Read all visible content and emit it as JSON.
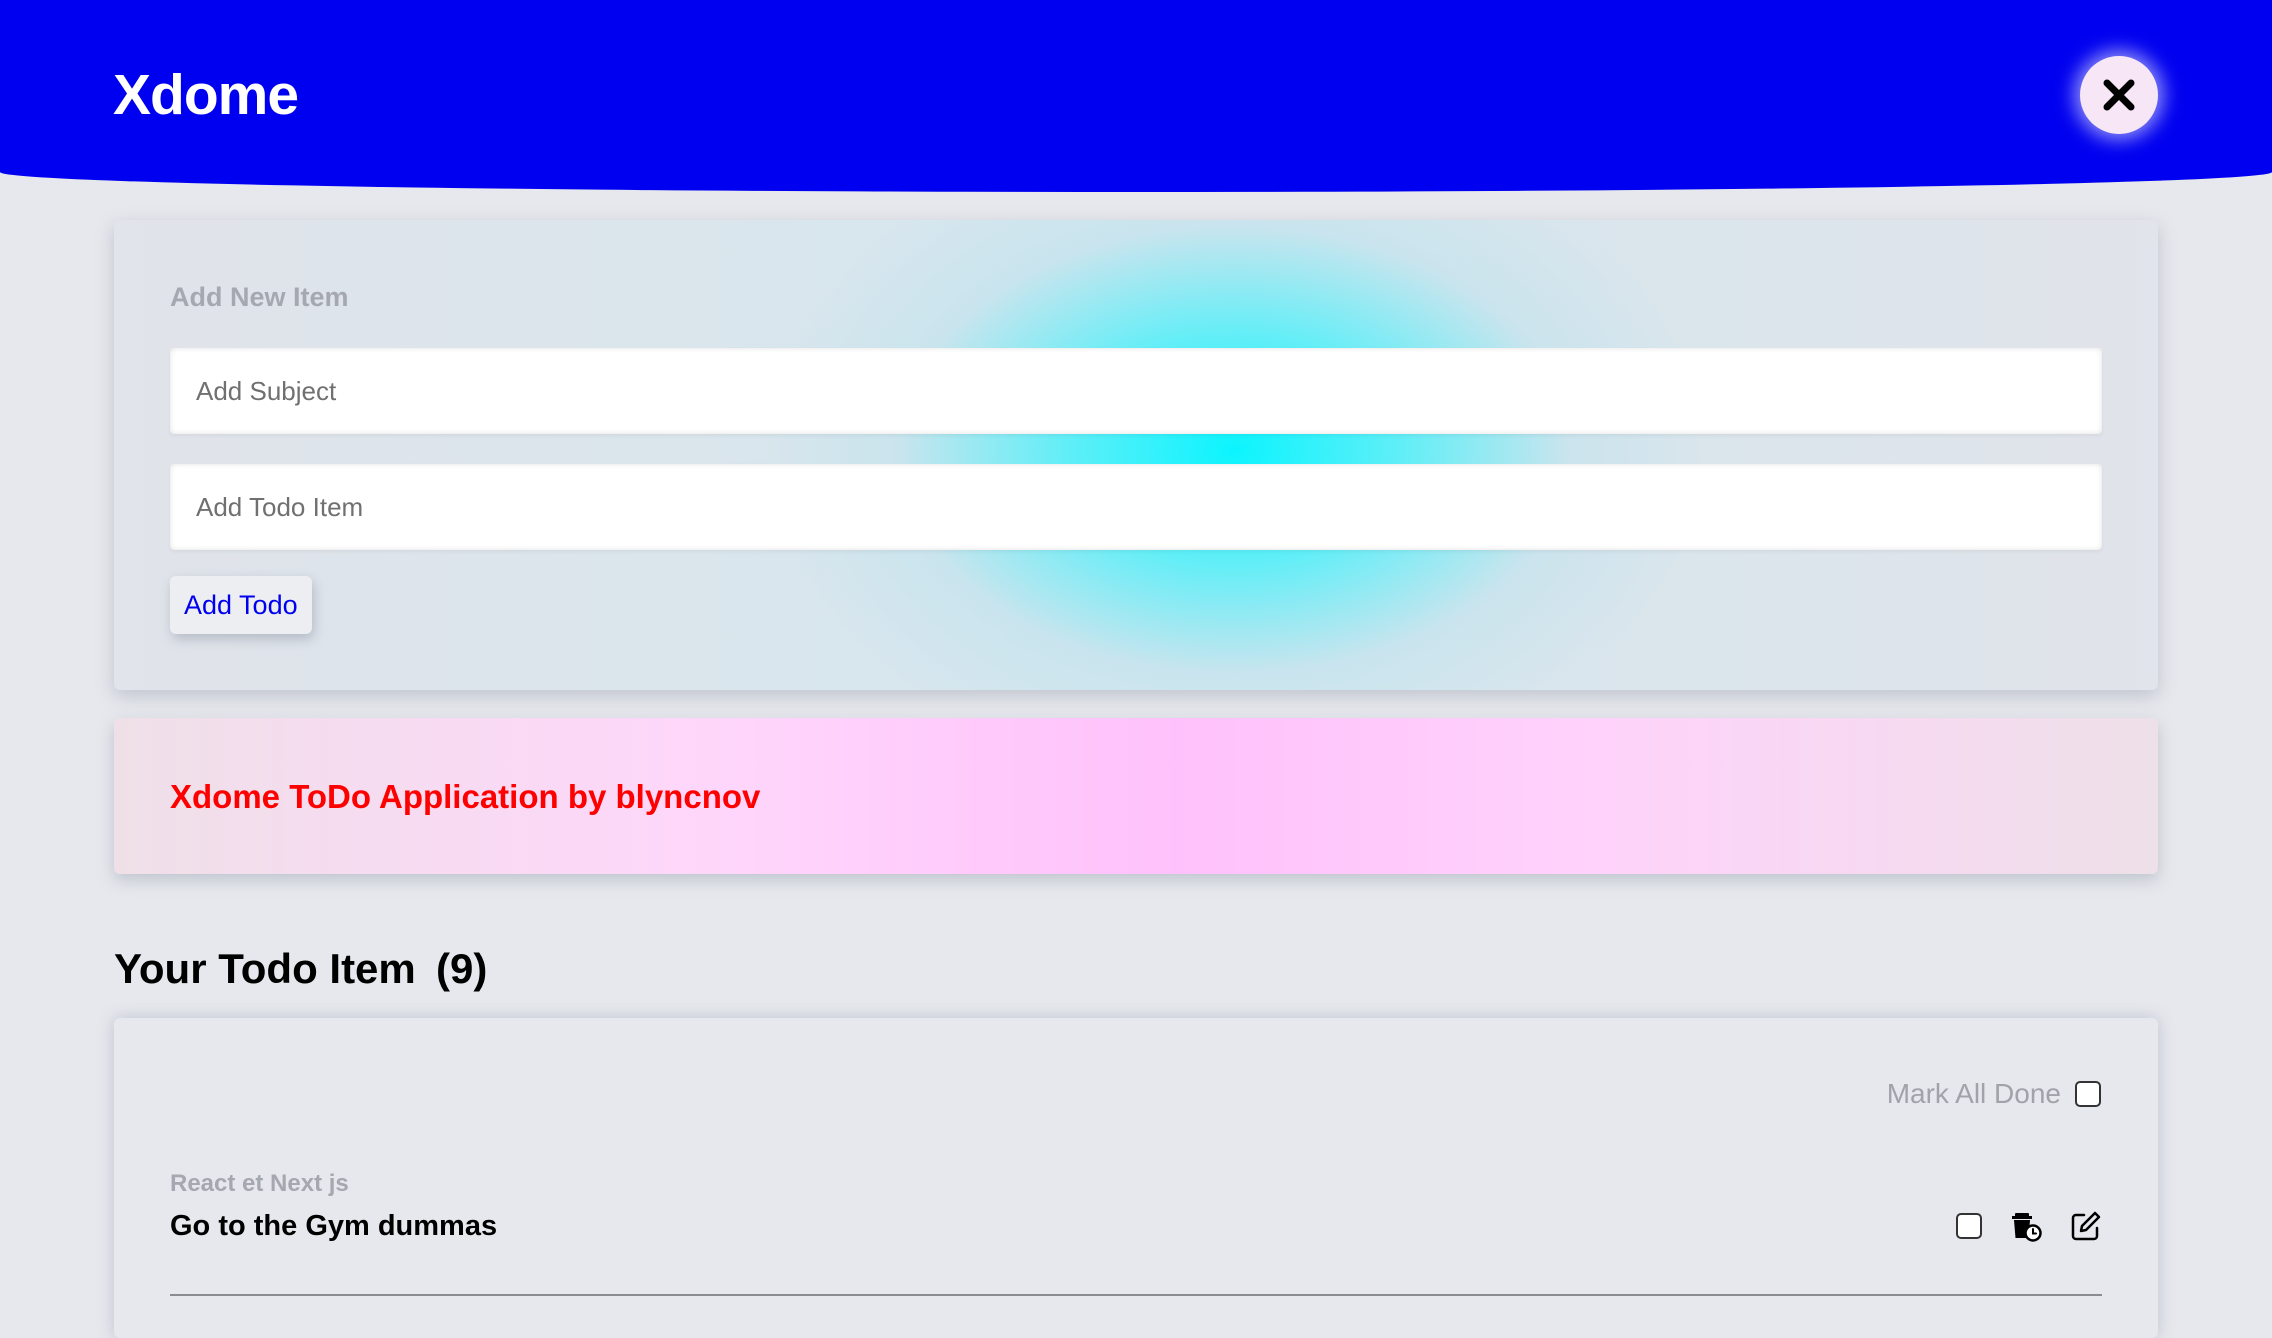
{
  "header": {
    "brand": "Xdome",
    "close_icon": "close-icon"
  },
  "add_form": {
    "title": "Add New Item",
    "subject_placeholder": "Add Subject",
    "todo_placeholder": "Add Todo Item",
    "subject_value": "",
    "todo_value": "",
    "add_label": "Add Todo"
  },
  "banner": {
    "text": "Xdome ToDo Application by blyncnov"
  },
  "todo_list": {
    "heading": "Your Todo Item",
    "count": "(9)",
    "mark_all_label": "Mark All Done",
    "items": [
      {
        "subject": "React et Next js",
        "title": "Go to the Gym dummas",
        "icons": [
          "checkbox",
          "trash-clock-icon",
          "edit-icon"
        ]
      }
    ]
  },
  "colors": {
    "header_bg": "#0000f0",
    "banner_text": "#ff0000",
    "accent_button": "#0000ee",
    "cyan_glow": "#00f5ff",
    "pink_glow": "#ffc1fb"
  }
}
